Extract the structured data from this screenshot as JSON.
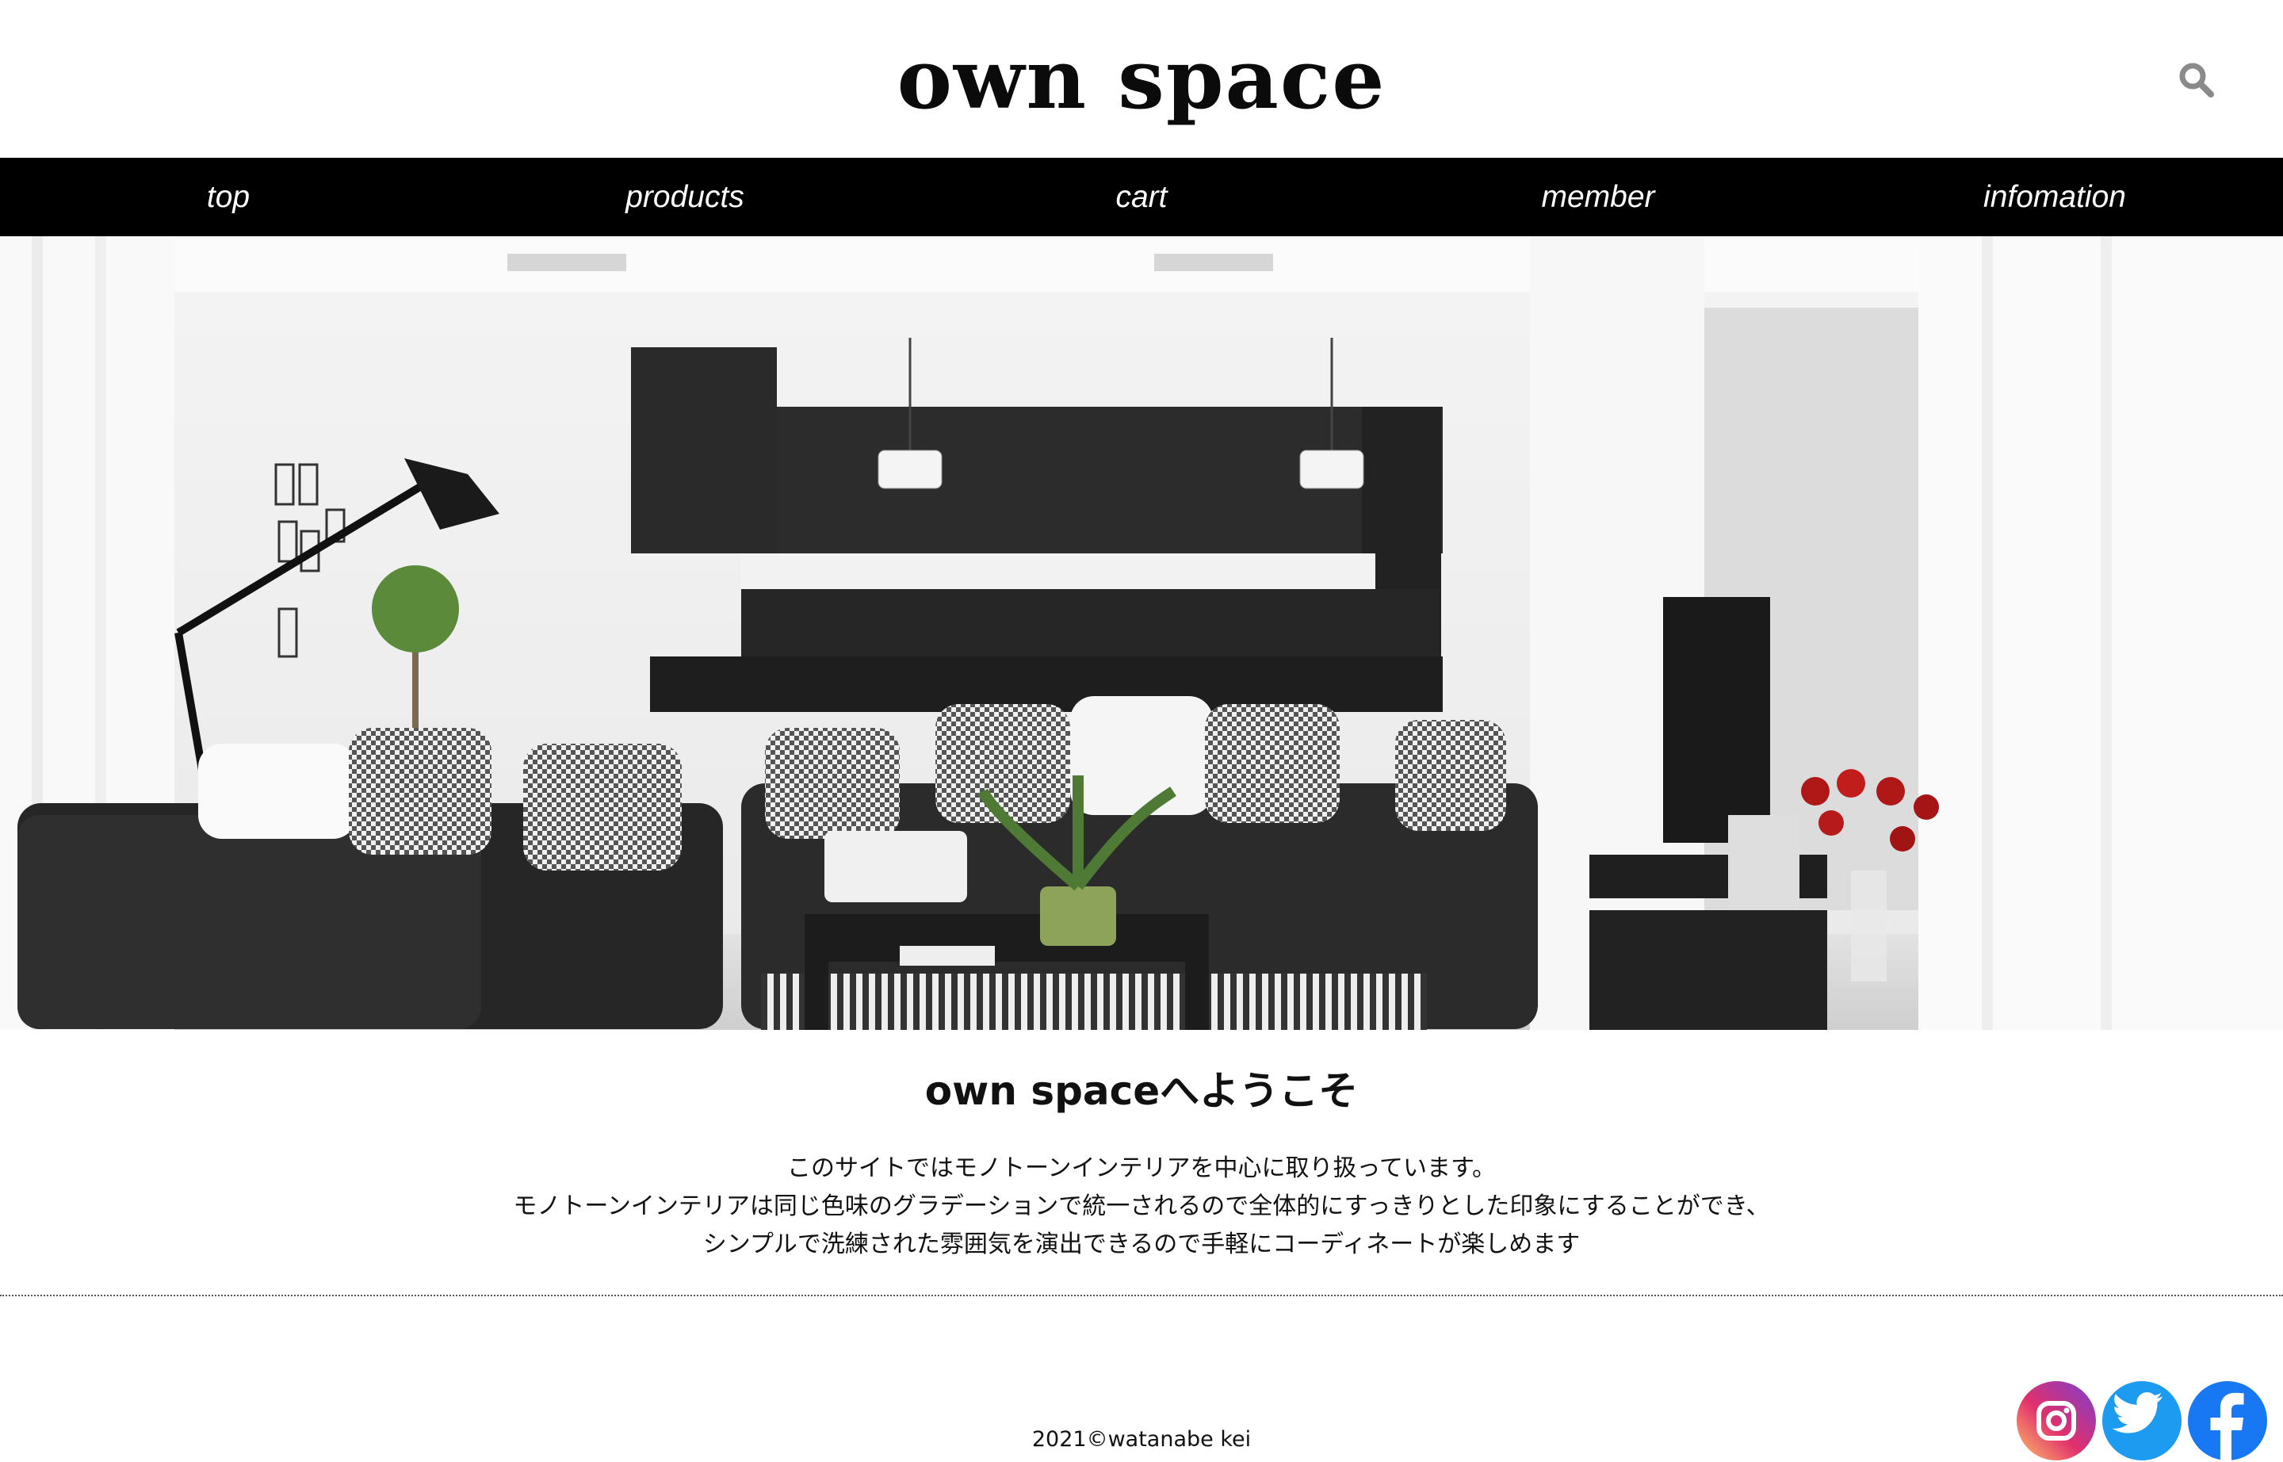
{
  "header": {
    "logo": "own space",
    "search_icon": "search-icon"
  },
  "nav": {
    "items": [
      {
        "label": "top"
      },
      {
        "label": "products"
      },
      {
        "label": "cart"
      },
      {
        "label": "member"
      },
      {
        "label": "infomation"
      }
    ]
  },
  "hero": {
    "image": "monotone living room with black sofas, black kitchen, floor lamp, TV and red roses"
  },
  "welcome": {
    "title": "own spaceへようこそ",
    "lines": [
      "このサイトではモノトーンインテリアを中心に取り扱っています。",
      "モノトーンインテリアは同じ色味のグラデーションで統一されるので全体的にすっきりとした印象にすることができ、",
      "シンプルで洗練された雰囲気を演出できるので手軽にコーディネートが楽しめます"
    ]
  },
  "footer": {
    "copyright": "2021©watanabe kei",
    "social": [
      {
        "icon": "instagram-icon"
      },
      {
        "icon": "twitter-icon"
      },
      {
        "icon": "facebook-icon"
      }
    ]
  },
  "colors": {
    "nav_bg": "#000000",
    "nav_text": "#ffffff",
    "search_icon": "#8a8a8a",
    "twitter": "#1d9bf0",
    "facebook": "#1877f2"
  }
}
